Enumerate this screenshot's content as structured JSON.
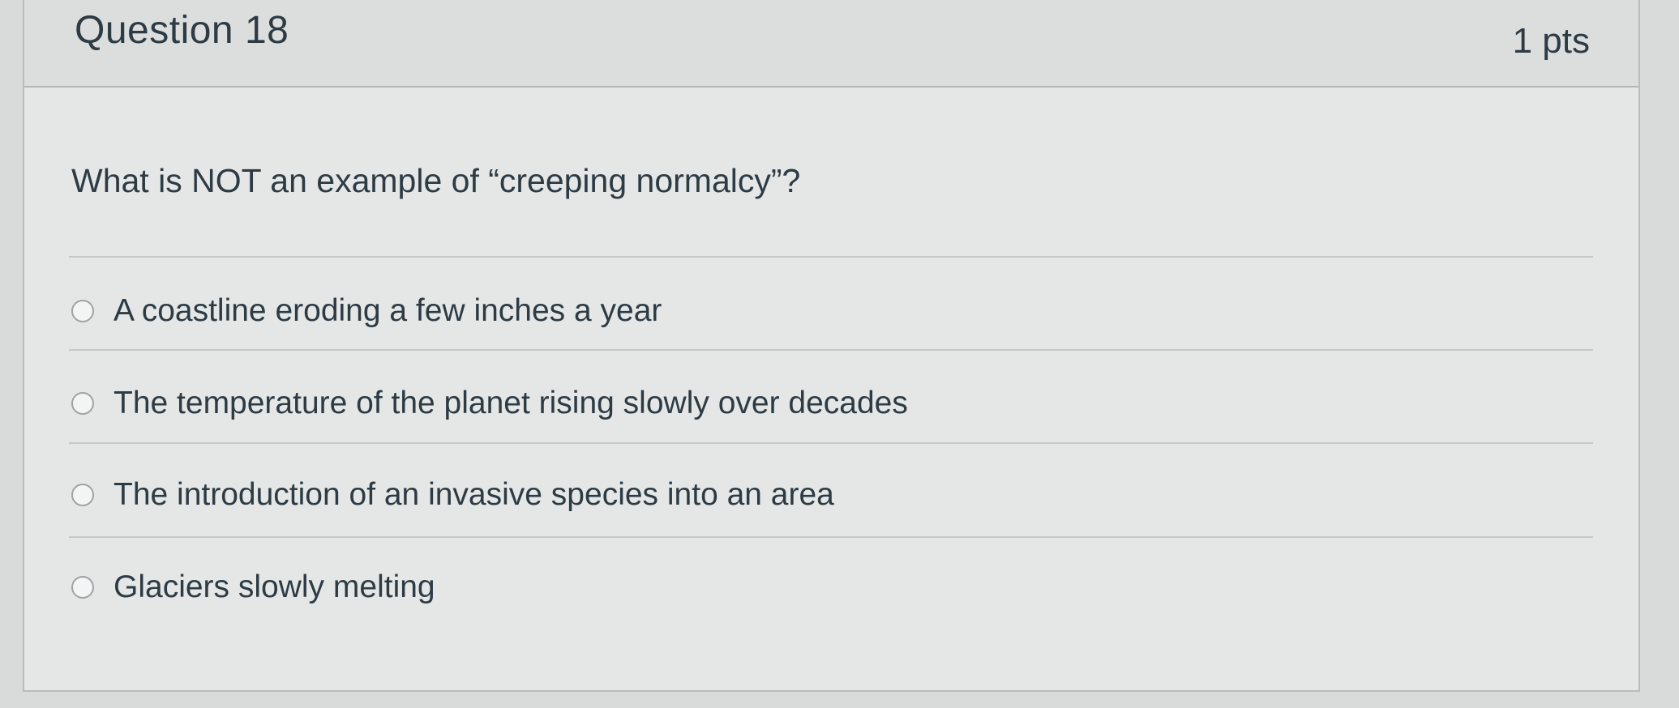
{
  "question": {
    "title": "Question 18",
    "points": "1 pts",
    "text": "What is NOT an example of “creeping normalcy”?"
  },
  "answers": [
    {
      "label": "A coastline eroding a few inches a year",
      "selected": false
    },
    {
      "label": "The temperature of the planet rising slowly over decades",
      "selected": false
    },
    {
      "label": "The introduction of an invasive species into an area",
      "selected": false
    },
    {
      "label": "Glaciers slowly melting",
      "selected": false
    }
  ]
}
